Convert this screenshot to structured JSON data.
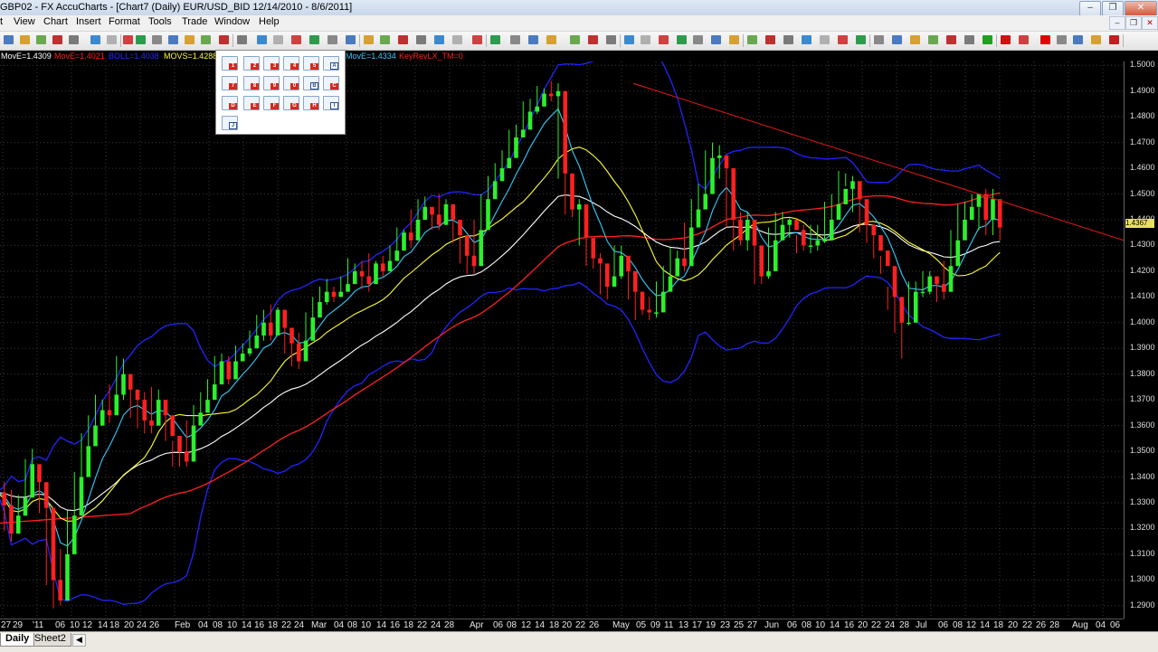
{
  "titlebar": {
    "title": "GBP02 - FX AccuCharts - [Chart7 (Daily)  EUR/USD_BID 12/14/2010 - 8/6/2011]"
  },
  "window_buttons": {
    "minimize": "–",
    "restore": "❐",
    "close": "✕"
  },
  "menu": [
    {
      "label": "t"
    },
    {
      "label": "View"
    },
    {
      "label": "Chart"
    },
    {
      "label": "Insert"
    },
    {
      "label": "Format"
    },
    {
      "label": "Tools"
    },
    {
      "label": "Trade"
    },
    {
      "label": "Window"
    },
    {
      "label": "Help"
    }
  ],
  "mdi_buttons": {
    "minimize": "–",
    "restore": "❐",
    "close": "✕"
  },
  "legend": [
    {
      "text": "MovE=1.4309",
      "color": "#ffffff"
    },
    {
      "text": "MovE=1.4021",
      "color": "#ff2020"
    },
    {
      "text": "BOLL=1.4038",
      "color": "#2a2aff"
    },
    {
      "text": "MOVS=1.4288",
      "color": "#ffff33"
    },
    {
      "text": "MovE=1.4334",
      "color": "#33ccff"
    },
    {
      "text": "KeyRevLX_TM=0",
      "color": "#ff2020"
    }
  ],
  "price_tag": "1.4367",
  "y_axis": [
    "1.5000",
    "1.4900",
    "1.4800",
    "1.4700",
    "1.4600",
    "1.4500",
    "1.4400",
    "1.4300",
    "1.4200",
    "1.4100",
    "1.4000",
    "1.3900",
    "1.3800",
    "1.3700",
    "1.3600",
    "1.3500",
    "1.3400",
    "1.3300",
    "1.3200",
    "1.3100",
    "1.3000",
    "1.2900"
  ],
  "x_axis": [
    "27",
    "29",
    "'11",
    "06",
    "10",
    "12",
    "14",
    "18",
    "20",
    "24",
    "26",
    "Feb",
    "04",
    "08",
    "10",
    "14",
    "16",
    "18",
    "22",
    "24",
    "Mar",
    "04",
    "08",
    "10",
    "14",
    "16",
    "18",
    "22",
    "24",
    "28",
    "Apr",
    "06",
    "08",
    "12",
    "14",
    "18",
    "20",
    "22",
    "26",
    "May",
    "05",
    "09",
    "11",
    "13",
    "17",
    "19",
    "23",
    "25",
    "27",
    "Jun",
    "06",
    "08",
    "10",
    "14",
    "16",
    "20",
    "22",
    "24",
    "28",
    "Jul",
    "06",
    "08",
    "12",
    "14",
    "18",
    "20",
    "22",
    "26",
    "28",
    "Aug",
    "04",
    "06"
  ],
  "sheets": [
    {
      "label": "Daily"
    },
    {
      "label": "Sheet2"
    }
  ],
  "palette_items": [
    "1",
    "2",
    "3",
    "4",
    "5",
    "A",
    "7",
    "8",
    "9",
    "0",
    "B",
    "C",
    "D",
    "E",
    "F",
    "G",
    "H",
    "I",
    "J"
  ],
  "colors": {
    "bull": "#2cf02c",
    "bear": "#ff2020",
    "bollinger": "#2323ff",
    "ema_fast": "#33ccff",
    "sma_mid": "#ffff33",
    "ema_slow": "#ffffff",
    "ema_long": "#ff2020",
    "trendline": "#d01818",
    "grid": "#3a3a3a"
  },
  "chart_data": {
    "type": "candlestick",
    "title": "Chart7 (Daily)  EUR/USD_BID 12/14/2010 - 8/6/2011",
    "ylim": [
      1.285,
      1.5015
    ],
    "close": [
      1.334,
      1.329,
      1.318,
      1.325,
      1.332,
      1.345,
      1.338,
      1.328,
      1.3,
      1.292,
      1.31,
      1.325,
      1.34,
      1.352,
      1.36,
      1.366,
      1.364,
      1.372,
      1.38,
      1.374,
      1.37,
      1.362,
      1.36,
      1.37,
      1.364,
      1.356,
      1.35,
      1.346,
      1.36,
      1.365,
      1.37,
      1.376,
      1.385,
      1.378,
      1.385,
      1.388,
      1.39,
      1.395,
      1.4,
      1.395,
      1.405,
      1.398,
      1.392,
      1.385,
      1.393,
      1.402,
      1.408,
      1.412,
      1.41,
      1.412,
      1.415,
      1.42,
      1.418,
      1.415,
      1.423,
      1.42,
      1.424,
      1.428,
      1.435,
      1.432,
      1.44,
      1.445,
      1.442,
      1.438,
      1.446,
      1.44,
      1.434,
      1.426,
      1.422,
      1.436,
      1.448,
      1.455,
      1.46,
      1.464,
      1.472,
      1.475,
      1.482,
      1.484,
      1.489,
      1.488,
      1.49,
      1.458,
      1.444,
      1.446,
      1.433,
      1.425,
      1.423,
      1.414,
      1.418,
      1.426,
      1.42,
      1.412,
      1.405,
      1.404,
      1.404,
      1.412,
      1.418,
      1.425,
      1.422,
      1.437,
      1.444,
      1.45,
      1.464,
      1.465,
      1.46,
      1.44,
      1.432,
      1.44,
      1.43,
      1.418,
      1.42,
      1.432,
      1.438,
      1.44,
      1.436,
      1.43,
      1.43,
      1.432,
      1.432,
      1.44,
      1.446,
      1.452,
      1.455,
      1.448,
      1.438,
      1.434,
      1.428,
      1.422,
      1.41,
      1.4,
      1.4,
      1.412,
      1.412,
      1.418,
      1.415,
      1.412,
      1.422,
      1.432,
      1.44,
      1.445,
      1.45,
      1.44,
      1.448,
      1.437
    ],
    "high": [
      1.343,
      1.338,
      1.335,
      1.333,
      1.347,
      1.351,
      1.344,
      1.331,
      1.305,
      1.312,
      1.327,
      1.342,
      1.357,
      1.364,
      1.372,
      1.37,
      1.376,
      1.387,
      1.386,
      1.377,
      1.373,
      1.373,
      1.375,
      1.374,
      1.366,
      1.354,
      1.352,
      1.362,
      1.368,
      1.373,
      1.378,
      1.387,
      1.388,
      1.387,
      1.391,
      1.392,
      1.397,
      1.403,
      1.405,
      1.407,
      1.406,
      1.399,
      1.393,
      1.396,
      1.404,
      1.41,
      1.414,
      1.417,
      1.414,
      1.418,
      1.425,
      1.423,
      1.424,
      1.427,
      1.424,
      1.426,
      1.43,
      1.437,
      1.436,
      1.444,
      1.448,
      1.449,
      1.443,
      1.45,
      1.448,
      1.441,
      1.435,
      1.427,
      1.44,
      1.45,
      1.457,
      1.462,
      1.467,
      1.475,
      1.477,
      1.486,
      1.487,
      1.492,
      1.491,
      1.494,
      1.493,
      1.46,
      1.449,
      1.448,
      1.437,
      1.429,
      1.427,
      1.422,
      1.43,
      1.43,
      1.424,
      1.413,
      1.409,
      1.41,
      1.416,
      1.422,
      1.429,
      1.428,
      1.439,
      1.448,
      1.454,
      1.467,
      1.47,
      1.469,
      1.463,
      1.44,
      1.443,
      1.443,
      1.434,
      1.426,
      1.437,
      1.443,
      1.443,
      1.441,
      1.434,
      1.438,
      1.438,
      1.438,
      1.447,
      1.45,
      1.459,
      1.458,
      1.457,
      1.45,
      1.438,
      1.436,
      1.426,
      1.414,
      1.412,
      1.407,
      1.416,
      1.416,
      1.42,
      1.42,
      1.418,
      1.424,
      1.436,
      1.446,
      1.447,
      1.45,
      1.45,
      1.452,
      1.452,
      1.444
    ],
    "low": [
      1.332,
      1.319,
      1.315,
      1.318,
      1.325,
      1.336,
      1.326,
      1.298,
      1.289,
      1.29,
      1.306,
      1.323,
      1.338,
      1.348,
      1.356,
      1.36,
      1.361,
      1.37,
      1.37,
      1.363,
      1.359,
      1.357,
      1.357,
      1.36,
      1.354,
      1.344,
      1.344,
      1.344,
      1.358,
      1.363,
      1.368,
      1.374,
      1.376,
      1.376,
      1.382,
      1.385,
      1.387,
      1.392,
      1.393,
      1.393,
      1.395,
      1.388,
      1.383,
      1.382,
      1.39,
      1.4,
      1.406,
      1.407,
      1.408,
      1.41,
      1.413,
      1.415,
      1.413,
      1.412,
      1.418,
      1.418,
      1.422,
      1.425,
      1.43,
      1.429,
      1.438,
      1.44,
      1.436,
      1.436,
      1.438,
      1.431,
      1.423,
      1.419,
      1.419,
      1.432,
      1.446,
      1.452,
      1.459,
      1.462,
      1.47,
      1.472,
      1.482,
      1.481,
      1.486,
      1.486,
      1.456,
      1.442,
      1.441,
      1.43,
      1.422,
      1.421,
      1.411,
      1.409,
      1.415,
      1.417,
      1.409,
      1.401,
      1.403,
      1.401,
      1.402,
      1.411,
      1.416,
      1.418,
      1.42,
      1.436,
      1.442,
      1.449,
      1.463,
      1.456,
      1.437,
      1.428,
      1.43,
      1.428,
      1.415,
      1.415,
      1.417,
      1.43,
      1.435,
      1.433,
      1.427,
      1.428,
      1.427,
      1.428,
      1.431,
      1.439,
      1.444,
      1.453,
      1.443,
      1.435,
      1.431,
      1.425,
      1.419,
      1.405,
      1.396,
      1.386,
      1.399,
      1.407,
      1.41,
      1.411,
      1.408,
      1.409,
      1.42,
      1.43,
      1.438,
      1.44,
      1.436,
      1.434,
      1.434,
      1.432
    ],
    "indicators": [
      {
        "name": "MovE",
        "value": 1.4309
      },
      {
        "name": "MovE",
        "value": 1.4021
      },
      {
        "name": "BOLL",
        "value": 1.4038
      },
      {
        "name": "MOVS",
        "value": 1.4288
      },
      {
        "name": "MovE",
        "value": 1.4334
      },
      {
        "name": "KeyRevLX_TM",
        "value": 0
      }
    ],
    "trendlines": [
      {
        "from": [
          "May 04",
          1.493
        ],
        "to": [
          "Aug 12",
          1.432
        ],
        "color": "red"
      }
    ],
    "grid": true
  }
}
